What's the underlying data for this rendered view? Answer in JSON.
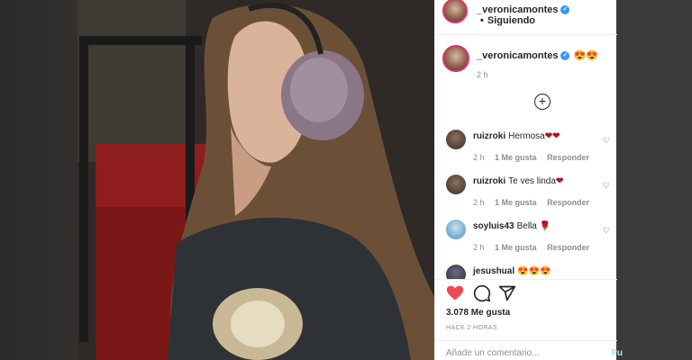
{
  "post": {
    "username": "_veronicamontes",
    "follow_status": "Siguiendo",
    "header_separator": "•",
    "caption_emoji": "😍😍",
    "caption_time": "2 h",
    "like_count_text": "3.078 Me gusta",
    "posted_ago": "HACE 2 HORAS"
  },
  "comments": [
    {
      "user": "ruizroki",
      "text": "Hermosa",
      "hearts": "❤❤",
      "time": "2 h",
      "likes": "1 Me gusta",
      "reply": "Responder"
    },
    {
      "user": "ruizroki",
      "text": "Te ves linda",
      "hearts": "❤",
      "time": "2 h",
      "likes": "1 Me gusta",
      "reply": "Responder"
    },
    {
      "user": "soyluis43",
      "text": "Bella",
      "hearts": "🌹",
      "time": "2 h",
      "likes": "1 Me gusta",
      "reply": "Responder"
    },
    {
      "user": "jesushual",
      "text": "😍😍😍",
      "hearts": "",
      "time": "",
      "likes": "",
      "reply": ""
    }
  ],
  "comment_box": {
    "placeholder": "Añade un comentario...",
    "publish_label": "Pu"
  },
  "icons": {
    "like": "heart-filled-icon",
    "comment": "comment-bubble-icon",
    "share": "paper-plane-icon",
    "load_more": "plus-circle-icon",
    "verified": "verified-badge-icon"
  },
  "colors": {
    "like_red": "#ed4956",
    "verified_blue": "#3897f0",
    "text_primary": "#262626",
    "text_secondary": "#8e8e8e"
  }
}
